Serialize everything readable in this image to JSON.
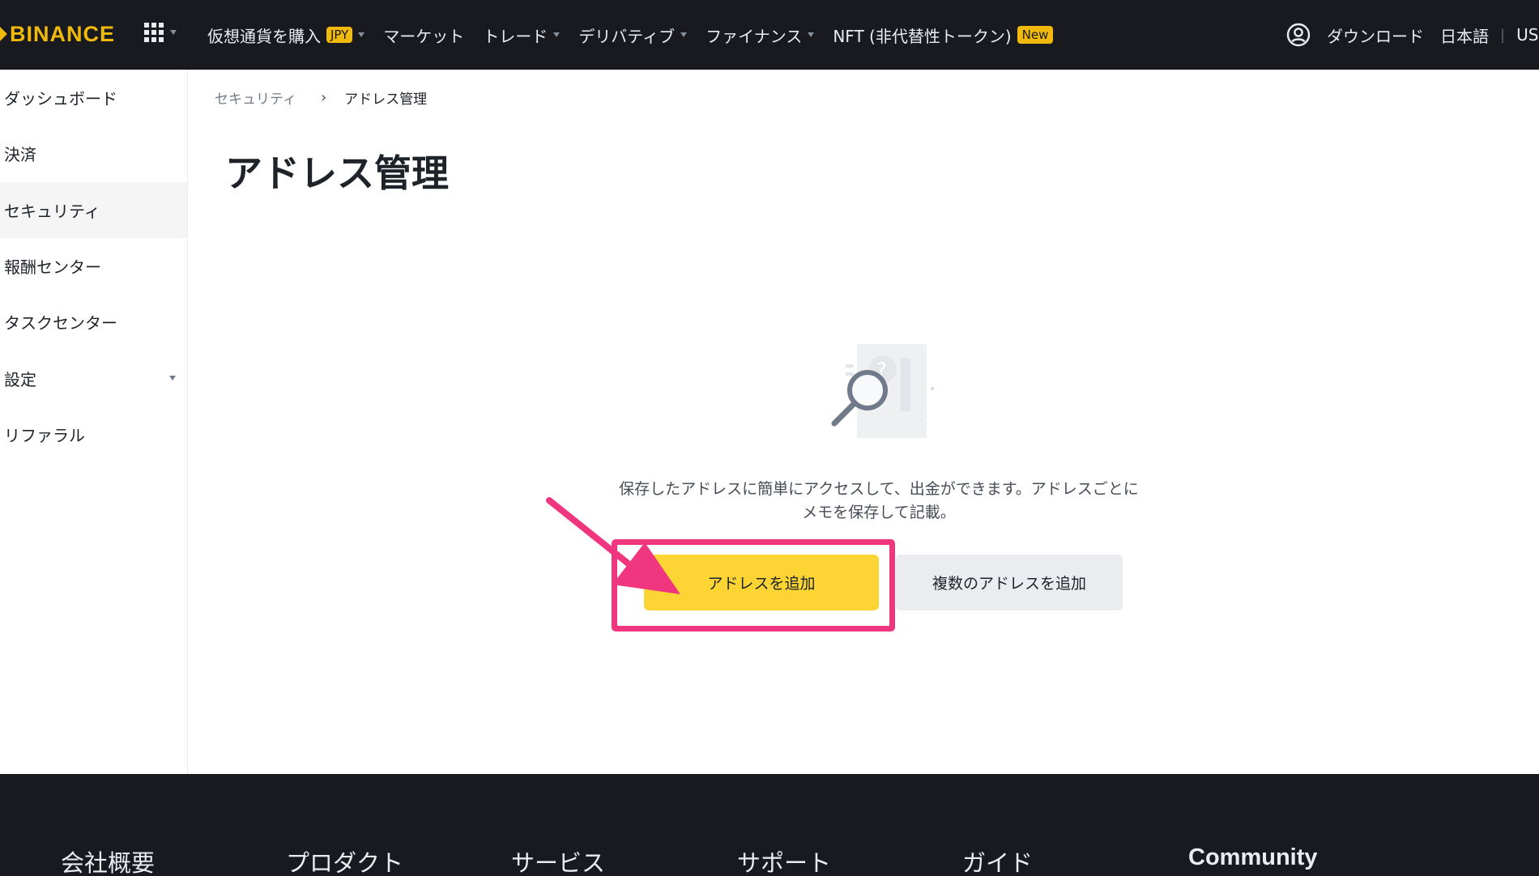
{
  "brand": {
    "name": "BINANCE",
    "accent": "#f0b90b"
  },
  "topnav": {
    "items": [
      {
        "label": "仮想通貨を購入",
        "badge": "JPY",
        "dropdown": true
      },
      {
        "label": "マーケット"
      },
      {
        "label": "トレード",
        "dropdown": true
      },
      {
        "label": "デリバティブ",
        "dropdown": true
      },
      {
        "label": "ファイナンス",
        "dropdown": true
      },
      {
        "label": "NFT (非代替性トークン)",
        "badge": "New"
      }
    ],
    "right": {
      "download": "ダウンロード",
      "language": "日本語",
      "separator": "|",
      "currency": "US"
    }
  },
  "sidebar": {
    "items": [
      {
        "label": "ダッシュボード"
      },
      {
        "label": "決済"
      },
      {
        "label": "セキュリティ",
        "active": true
      },
      {
        "label": "報酬センター"
      },
      {
        "label": "タスクセンター"
      },
      {
        "label": "設定",
        "expandable": true
      },
      {
        "label": "リファラル"
      }
    ]
  },
  "breadcrumb": {
    "parent": "セキュリティ",
    "separator": "›",
    "current": "アドレス管理"
  },
  "page": {
    "title": "アドレス管理",
    "empty_message_line1": "保存したアドレスに簡単にアクセスして、出金ができます。アドレスごとに",
    "empty_message_line2": "メモを保存して記載。",
    "add_address_button": "アドレスを追加",
    "add_multiple_button": "複数のアドレスを追加"
  },
  "annotation": {
    "highlight_color": "#f0367e"
  },
  "footer": {
    "columns": [
      "会社概要",
      "プロダクト",
      "サービス",
      "サポート",
      "ガイド",
      "Community"
    ]
  }
}
